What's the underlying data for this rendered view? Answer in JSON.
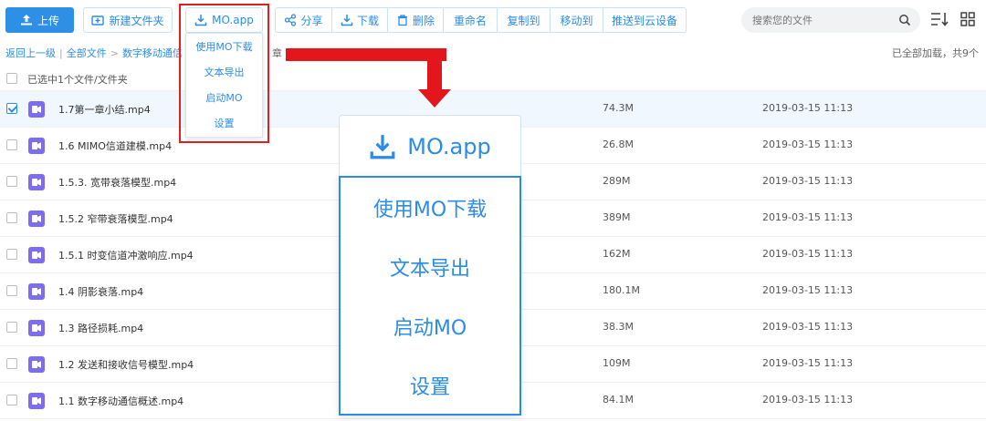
{
  "toolbar": {
    "upload": "上传",
    "new_folder": "新建文件夹",
    "mo_app": "MO.app",
    "share": "分享",
    "download": "下载",
    "delete": "删除",
    "rename": "重命名",
    "copy_to": "复制到",
    "move_to": "移动到",
    "push_cloud": "推送到云设备",
    "search_placeholder": "搜索您的文件"
  },
  "breadcrumb": {
    "back": "返回上一级",
    "all_files": "全部文件",
    "current": "数字移动通信",
    "current_tail": "章"
  },
  "status": {
    "loaded": "已全部加载，共9个",
    "selected": "已选中1个文件/文件夹"
  },
  "mo_menu": {
    "items": [
      "使用MO下载",
      "文本导出",
      "启动MO",
      "设置"
    ]
  },
  "files": [
    {
      "name": "1.7第一章小结.mp4",
      "size": "74.3M",
      "date": "2019-03-15 11:13",
      "selected": true
    },
    {
      "name": "1.6 MIMO信道建模.mp4",
      "size": "26.8M",
      "date": "2019-03-15 11:13",
      "selected": false
    },
    {
      "name": "1.5.3. 宽带衰落模型.mp4",
      "size": "289M",
      "date": "2019-03-15 11:13",
      "selected": false
    },
    {
      "name": "1.5.2 窄带衰落模型.mp4",
      "size": "389M",
      "date": "2019-03-15 11:13",
      "selected": false
    },
    {
      "name": "1.5.1 时变信道冲激响应.mp4",
      "size": "162M",
      "date": "2019-03-15 11:13",
      "selected": false
    },
    {
      "name": "1.4 阴影衰落.mp4",
      "size": "180.1M",
      "date": "2019-03-15 11:13",
      "selected": false
    },
    {
      "name": "1.3 路径损耗.mp4",
      "size": "38.3M",
      "date": "2019-03-15 11:13",
      "selected": false
    },
    {
      "name": "1.2 发送和接收信号模型.mp4",
      "size": "109M",
      "date": "2019-03-15 11:13",
      "selected": false
    },
    {
      "name": "1.1 数字移动通信概述.mp4",
      "size": "84.1M",
      "date": "2019-03-15 11:13",
      "selected": false
    }
  ],
  "colors": {
    "accent": "#2b8ce8",
    "highlight": "#e3171b",
    "video_icon": "#7b6cf0"
  }
}
